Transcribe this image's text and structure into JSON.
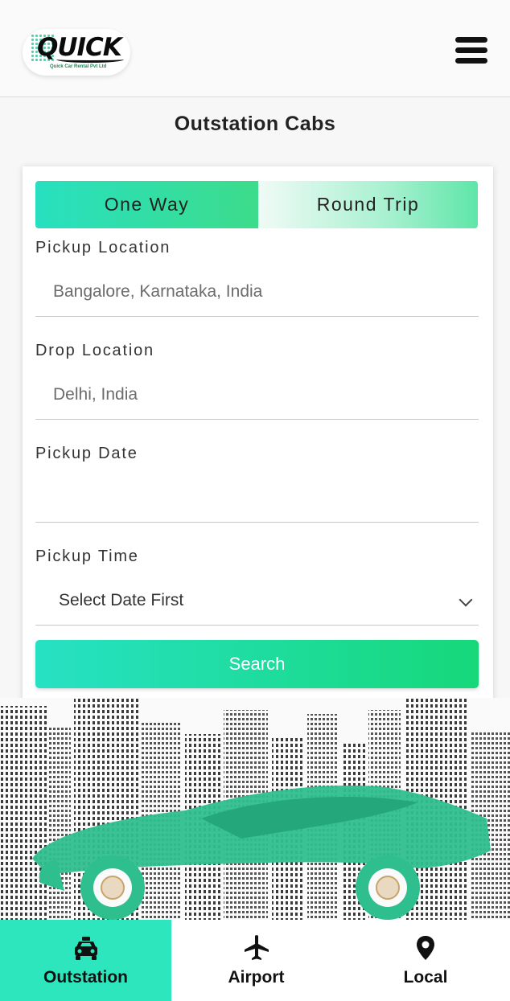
{
  "header": {
    "logo_text": "QUICK",
    "logo_subtext": "Quick Car Rental Pvt Ltd",
    "menu_icon": "hamburger-menu-icon"
  },
  "page": {
    "title": "Outstation Cabs"
  },
  "trip_tabs": [
    {
      "label": "One Way",
      "selected": true
    },
    {
      "label": "Round Trip",
      "selected": false
    }
  ],
  "form": {
    "pickup_location": {
      "label": "Pickup Location",
      "value": "Bangalore, Karnataka, India"
    },
    "drop_location": {
      "label": "Drop Location",
      "value": "Delhi, India"
    },
    "pickup_date": {
      "label": "Pickup Date",
      "value": ""
    },
    "pickup_time": {
      "label": "Pickup Time",
      "value": "Select Date First"
    },
    "search_label": "Search"
  },
  "bottom_nav": [
    {
      "label": "Outstation",
      "icon": "taxi-icon",
      "active": true
    },
    {
      "label": "Airport",
      "icon": "airplane-icon",
      "active": false
    },
    {
      "label": "Local",
      "icon": "location-pin-icon",
      "active": false
    }
  ],
  "colors": {
    "accent": "#2de6bd",
    "accent_green": "#16d87a",
    "car": "#2fbf8f"
  }
}
